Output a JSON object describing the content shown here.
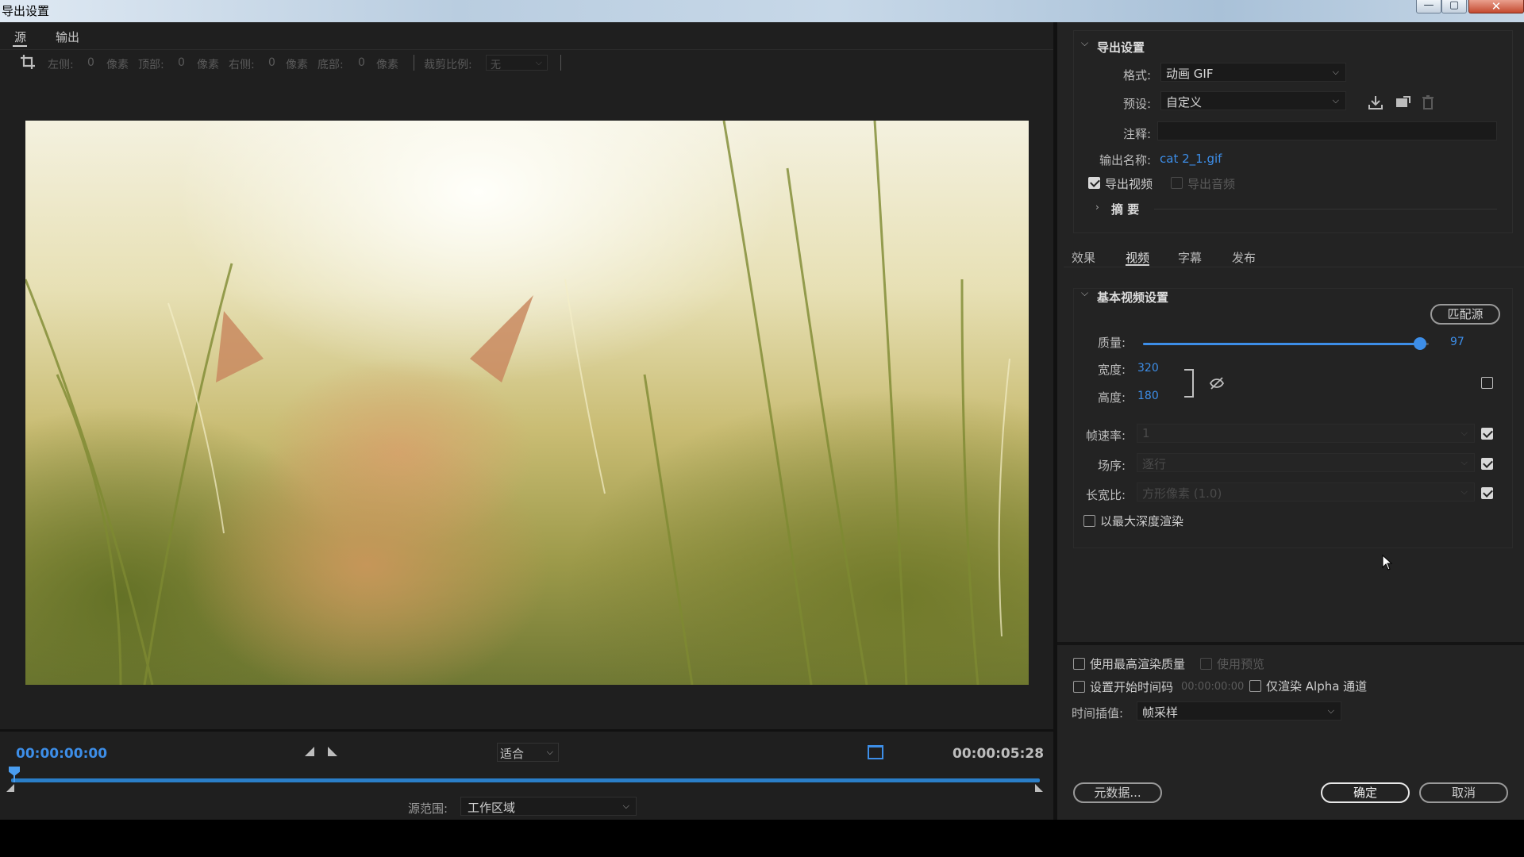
{
  "window": {
    "title": "导出设置",
    "controls": {
      "minimize": "—",
      "maximize": "▢",
      "close": "✕"
    }
  },
  "left": {
    "tabs": [
      {
        "label": "源"
      },
      {
        "label": "输出"
      }
    ],
    "crop": {
      "left_label": "左侧:",
      "left_value": "0",
      "left_unit": "像素",
      "top_label": "顶部:",
      "top_value": "0",
      "top_unit": "像素",
      "right_label": "右侧:",
      "right_value": "0",
      "right_unit": "像素",
      "bottom_label": "底部:",
      "bottom_value": "0",
      "bottom_unit": "像素",
      "ratio_label": "裁剪比例:",
      "ratio_value": "无"
    },
    "timeline": {
      "timecode_start": "00:00:00:00",
      "timecode_end": "00:00:05:28",
      "zoom": "适合",
      "source_range_label": "源范围:",
      "source_range_value": "工作区域",
      "playhead_fraction": 0.0
    }
  },
  "right": {
    "export_settings": {
      "title": "导出设置",
      "format_label": "格式:",
      "format_value": "动画 GIF",
      "preset_label": "预设:",
      "preset_value": "自定义",
      "comment_label": "注释:",
      "comment_value": "",
      "output_name_label": "输出名称:",
      "output_name_value": "cat 2_1.gif",
      "export_video_label": "导出视频",
      "export_video_checked": true,
      "export_audio_label": "导出音频",
      "export_audio_checked": false,
      "summary_label": "摘 要"
    },
    "tabs": [
      {
        "label": "效果"
      },
      {
        "label": "视频"
      },
      {
        "label": "字幕"
      },
      {
        "label": "发布"
      }
    ],
    "active_tab": "视频",
    "basic_video": {
      "title": "基本视频设置",
      "match_source": "匹配源",
      "quality_label": "质量:",
      "quality_value": "97",
      "quality_fraction": 0.97,
      "width_label": "宽度:",
      "width_value": "320",
      "height_label": "高度:",
      "height_value": "180",
      "framerate_label": "帧速率:",
      "framerate_value": "1",
      "field_order_label": "场序:",
      "field_order_value": "逐行",
      "aspect_label": "长宽比:",
      "aspect_value": "方形像素 (1.0)",
      "max_depth_label": "以最大深度渲染"
    },
    "bottom": {
      "max_quality_label": "使用最高渲染质量",
      "use_preview_label": "使用预览",
      "set_start_tc_label": "设置开始时间码",
      "start_tc_value": "00:00:00:00",
      "alpha_only_label": "仅渲染 Alpha 通道",
      "interp_label": "时间插值:",
      "interp_value": "帧采样",
      "metadata_button": "元数据...",
      "ok_button": "确定",
      "cancel_button": "取消"
    }
  },
  "colors": {
    "accent": "#3d8ee8",
    "panel": "#232323",
    "background": "#1f1f1f"
  }
}
